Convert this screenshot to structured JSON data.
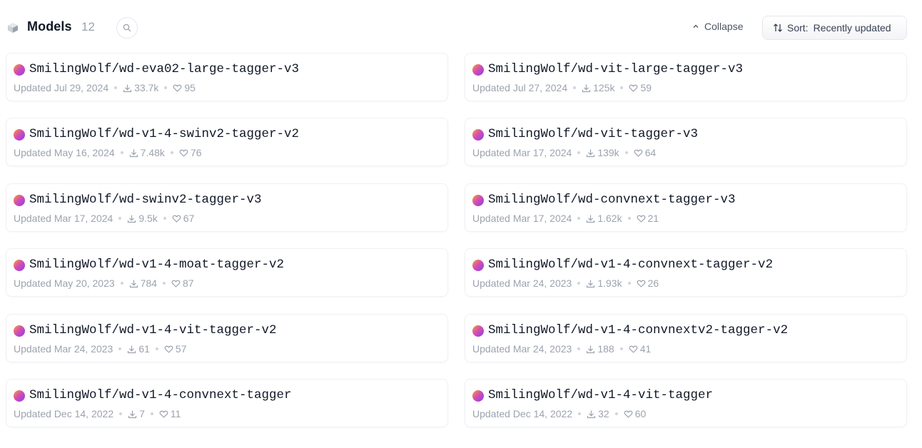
{
  "header": {
    "title": "Models",
    "count": "12",
    "collapse_label": "Collapse",
    "sort_label": "Sort:",
    "sort_value": "Recently updated"
  },
  "models": [
    {
      "name": "SmilingWolf/wd-eva02-large-tagger-v3",
      "updated": "Updated Jul 29, 2024",
      "downloads": "33.7k",
      "likes": "95"
    },
    {
      "name": "SmilingWolf/wd-vit-large-tagger-v3",
      "updated": "Updated Jul 27, 2024",
      "downloads": "125k",
      "likes": "59"
    },
    {
      "name": "SmilingWolf/wd-v1-4-swinv2-tagger-v2",
      "updated": "Updated May 16, 2024",
      "downloads": "7.48k",
      "likes": "76"
    },
    {
      "name": "SmilingWolf/wd-vit-tagger-v3",
      "updated": "Updated Mar 17, 2024",
      "downloads": "139k",
      "likes": "64"
    },
    {
      "name": "SmilingWolf/wd-swinv2-tagger-v3",
      "updated": "Updated Mar 17, 2024",
      "downloads": "9.5k",
      "likes": "67"
    },
    {
      "name": "SmilingWolf/wd-convnext-tagger-v3",
      "updated": "Updated Mar 17, 2024",
      "downloads": "1.62k",
      "likes": "21"
    },
    {
      "name": "SmilingWolf/wd-v1-4-moat-tagger-v2",
      "updated": "Updated May 20, 2023",
      "downloads": "784",
      "likes": "87"
    },
    {
      "name": "SmilingWolf/wd-v1-4-convnext-tagger-v2",
      "updated": "Updated Mar 24, 2023",
      "downloads": "1.93k",
      "likes": "26"
    },
    {
      "name": "SmilingWolf/wd-v1-4-vit-tagger-v2",
      "updated": "Updated Mar 24, 2023",
      "downloads": "61",
      "likes": "57"
    },
    {
      "name": "SmilingWolf/wd-v1-4-convnextv2-tagger-v2",
      "updated": "Updated Mar 24, 2023",
      "downloads": "188",
      "likes": "41"
    },
    {
      "name": "SmilingWolf/wd-v1-4-convnext-tagger",
      "updated": "Updated Dec 14, 2022",
      "downloads": "7",
      "likes": "11"
    },
    {
      "name": "SmilingWolf/wd-v1-4-vit-tagger",
      "updated": "Updated Dec 14, 2022",
      "downloads": "32",
      "likes": "60"
    }
  ],
  "icons": {
    "section": "cube-icon",
    "search": "search-icon",
    "collapse": "chevron-up-icon",
    "sort": "sort-arrows-icon",
    "download": "download-icon",
    "like": "heart-icon",
    "avatar": "org-avatar"
  },
  "colors": {
    "muted_text": "#9ca3af",
    "title_text": "#111827",
    "card_border": "#f0f1f4"
  }
}
